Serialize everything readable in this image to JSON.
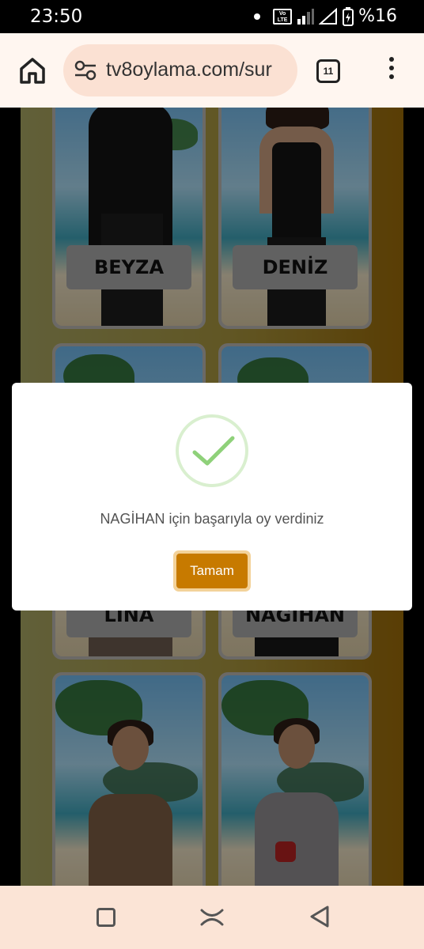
{
  "status_bar": {
    "time": "23:50",
    "volte_label": "Vo LTE",
    "battery": "%16"
  },
  "browser": {
    "url": "tv8oylama.com/sur",
    "tab_count": "11"
  },
  "contestants": [
    {
      "name": "BEYZA"
    },
    {
      "name": "DENİZ"
    },
    {
      "name": "LİNA"
    },
    {
      "name": "NAGİHAN"
    },
    {
      "name": ""
    },
    {
      "name": ""
    }
  ],
  "dialog": {
    "message": "NAGİHAN için başarıyla oy verdiniz",
    "ok_label": "Tamam",
    "accent": "#c77a00",
    "check_color": "#8fd17a"
  },
  "icons": {
    "home": "home-icon",
    "site_settings": "tune-icon",
    "tabs": "tabs-icon",
    "menu": "more-vert-icon",
    "success": "check-icon"
  }
}
